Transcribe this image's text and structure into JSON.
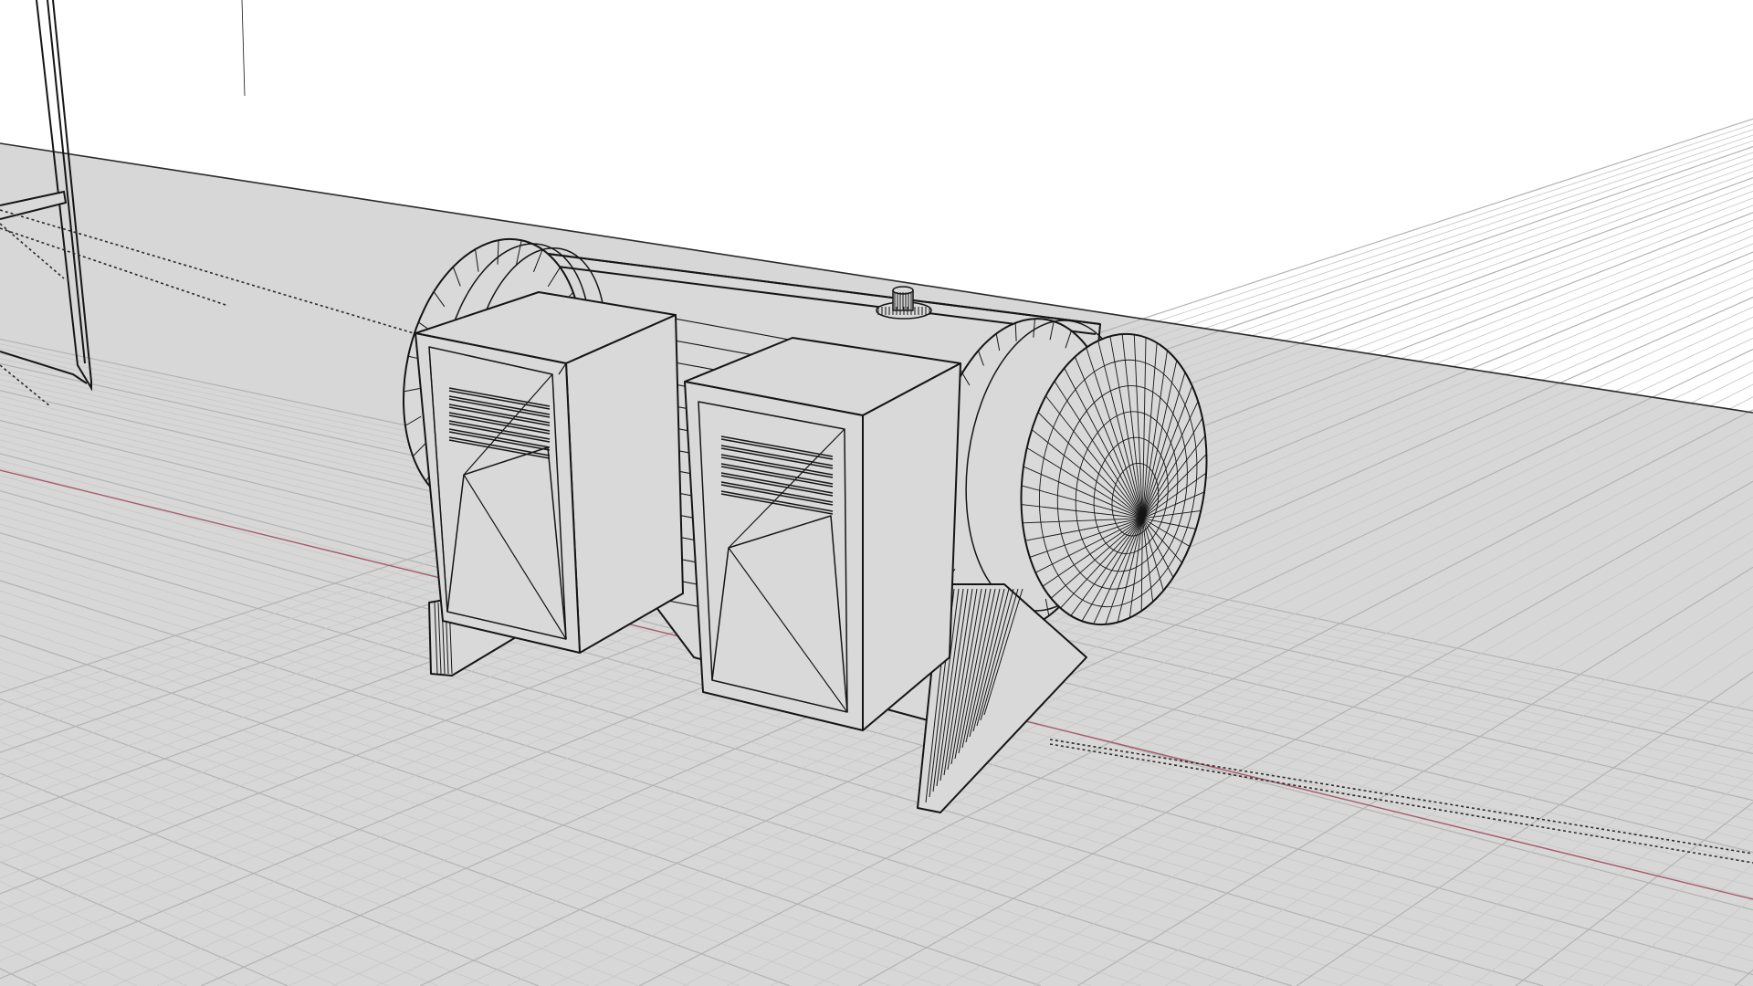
{
  "viewport": {
    "projection": "perspective",
    "display_mode": "wireframe",
    "colors": {
      "sky": "#ffffff",
      "ground": "#d7d7d7",
      "grid_minor": "#c9c9c9",
      "grid_major": "#b3b3b3",
      "x_axis": "#a65b6a",
      "wire": "#151515",
      "dotted": "#2a2a2a",
      "object_face": "#d9d9d9"
    }
  },
  "scene": {
    "objects": [
      {
        "name": "machine-housing",
        "type": "cylinder-mesh"
      },
      {
        "name": "left-flange",
        "type": "ring-mesh"
      },
      {
        "name": "right-flange",
        "type": "ring-mesh"
      },
      {
        "name": "end-cap-dome",
        "type": "dome-mesh"
      },
      {
        "name": "left-junction-box",
        "type": "box-mesh"
      },
      {
        "name": "right-junction-box",
        "type": "box-mesh"
      },
      {
        "name": "top-fitting",
        "type": "nut-mesh"
      },
      {
        "name": "left-support-leg",
        "type": "wedge-mesh"
      },
      {
        "name": "right-support-leg",
        "type": "wedge-mesh"
      },
      {
        "name": "background-frame",
        "type": "frame-mesh"
      }
    ]
  }
}
